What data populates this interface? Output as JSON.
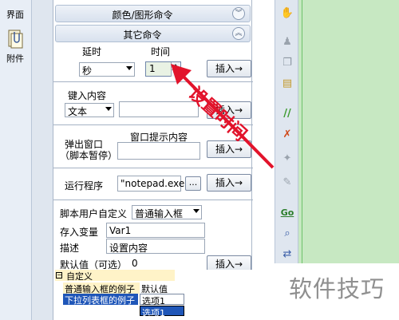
{
  "sidebar": {
    "items": [
      {
        "label": "界面",
        "icon": "interface-icon"
      },
      {
        "label": "附件",
        "icon": "attachment-icon"
      }
    ]
  },
  "panel": {
    "sections": [
      {
        "title": "颜色/图形命令",
        "state": "collapsed"
      },
      {
        "title": "其它命令",
        "state": "expanded"
      }
    ],
    "delay": {
      "label_delay": "延时",
      "label_time": "时间",
      "unit_selected": "秒",
      "time_value": "1",
      "insert_label": "插入→"
    },
    "key_input": {
      "label": "键入内容",
      "type_selected": "文本",
      "value": "",
      "insert_label": "插入→"
    },
    "popup": {
      "label_line1": "弹出窗口",
      "label_line2": "（脚本暂停）",
      "prompt_label": "窗口提示内容",
      "value": "",
      "insert_label": "插入→"
    },
    "run_program": {
      "label": "运行程序",
      "value": "\"notepad.exe\"",
      "browse_label": "...",
      "insert_label": "插入→"
    },
    "user_define": {
      "label": "脚本用户自定义",
      "type_selected": "普通输入框",
      "var_label": "存入变量",
      "var_value": "Var1",
      "desc_label": "描述",
      "desc_value": "设置内容",
      "default_label": "默认值（可选）",
      "default_value": "0",
      "insert_label": "插入→"
    },
    "grid": {
      "header": "自定义",
      "toggle": "⊟",
      "rows": [
        {
          "c1": "普通输入框的例子",
          "c2": "默认值"
        },
        {
          "c1": "下拉列表框的例子",
          "c2": "选项1"
        }
      ],
      "dropdown_option": "选项1"
    }
  },
  "annotation": {
    "text": "设置时间",
    "color": "#e2132b"
  },
  "watermark": "软件技巧",
  "toolbar_icons": [
    "hand-icon",
    "person-icon",
    "copy-icon",
    "paste-icon",
    "comment-icon",
    "uncomment-icon",
    "bookmark-icon",
    "pen-icon",
    "goto-icon",
    "find-icon",
    "replace-icon"
  ]
}
